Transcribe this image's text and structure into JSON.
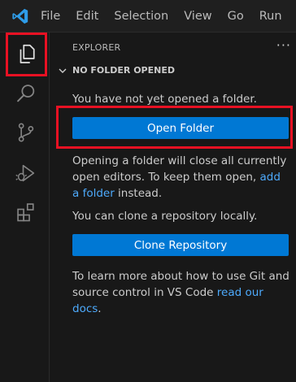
{
  "menu": [
    "File",
    "Edit",
    "Selection",
    "View",
    "Go",
    "Run"
  ],
  "activity": {
    "items": [
      {
        "name": "explorer-icon",
        "active": true
      },
      {
        "name": "search-icon",
        "active": false
      },
      {
        "name": "source-control-icon",
        "active": false
      },
      {
        "name": "run-debug-icon",
        "active": false
      },
      {
        "name": "extensions-icon",
        "active": false
      }
    ]
  },
  "sidebar": {
    "header": "EXPLORER",
    "more": "···",
    "section_title": "NO FOLDER OPENED",
    "msg_not_opened": "You have not yet opened a folder.",
    "open_folder_label": "Open Folder",
    "msg_opening": "Opening a folder will close all currently open editors. To keep them open,",
    "add_folder_link": "add a folder",
    "msg_instead": " instead.",
    "msg_clone": "You can clone a repository locally.",
    "clone_label": "Clone Repository",
    "msg_learn": "To learn more about how to use Git and source control in VS Code",
    "read_docs_link": "read our docs",
    "msg_end": "."
  },
  "colors": {
    "accent": "#0078d4",
    "highlight": "#e81123",
    "link": "#4daafc"
  }
}
